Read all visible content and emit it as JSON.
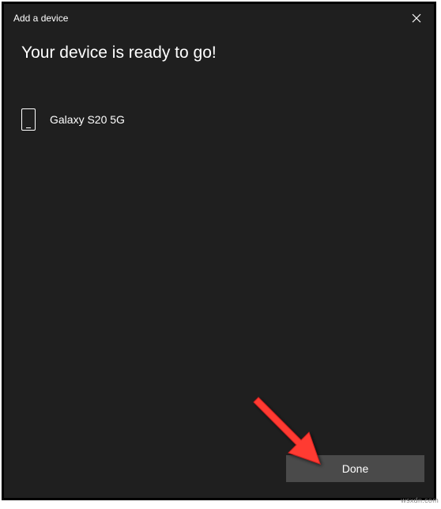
{
  "titlebar": {
    "title": "Add a device"
  },
  "heading": "Your device is ready to go!",
  "device": {
    "name": "Galaxy S20 5G"
  },
  "footer": {
    "done_label": "Done"
  },
  "watermark": "wsxdn.com"
}
